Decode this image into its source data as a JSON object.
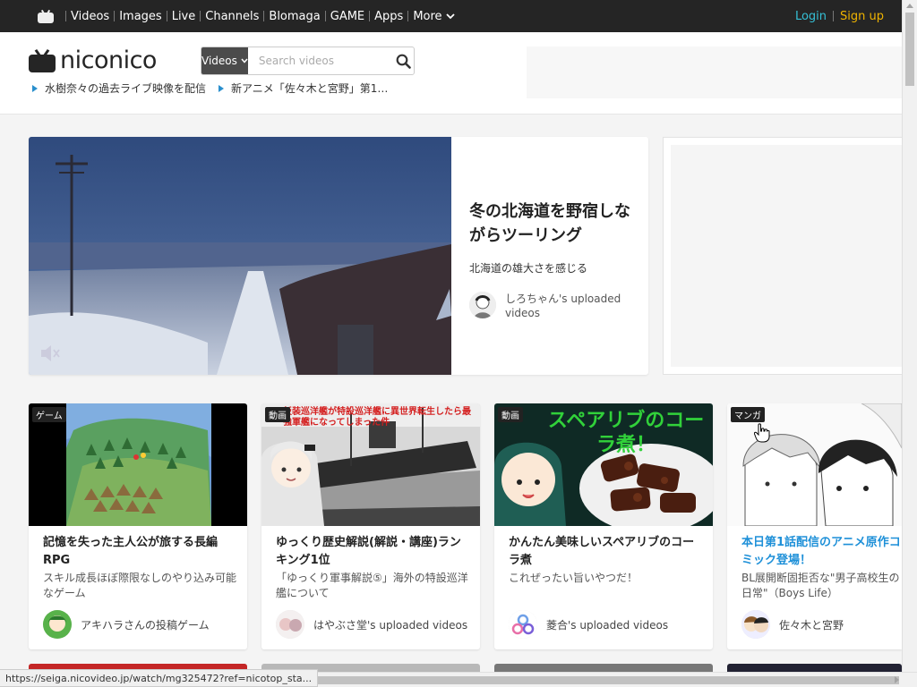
{
  "topbar": {
    "nav": [
      "Videos",
      "Images",
      "Live",
      "Channels",
      "Blomaga",
      "GAME",
      "Apps"
    ],
    "more_label": "More",
    "login_label": "Login",
    "signup_label": "Sign up"
  },
  "header": {
    "logo_text": "niconico",
    "search_type": "Videos",
    "search_placeholder": "Search videos",
    "pickups": [
      "水樹奈々の過去ライブ映像を配信",
      "新アニメ「佐々木と宮野」第1…"
    ]
  },
  "feature": {
    "title": "冬の北海道を野宿しながらツーリング",
    "subtitle": "北海道の雄大さを感じる",
    "author": "しろちゃん's uploaded videos"
  },
  "cards": [
    {
      "badge": "ゲーム",
      "title": "記憶を失った主人公が旅する長編RPG",
      "desc": "スキル成長ほぼ際限なしのやり込み可能なゲーム",
      "author": "アキハラさんの投稿ゲーム"
    },
    {
      "badge": "動画",
      "title": "ゆっくり歴史解説(解説・講座)ランキング1位",
      "desc": "「ゆっくり軍事解説⑤」海外の特設巡洋艦について",
      "author": "はやぶさ堂's uploaded videos"
    },
    {
      "badge": "動画",
      "title": "かんたん美味しいスペアリブのコーラ煮",
      "desc": "これぜったい旨いやつだ！",
      "author": "菱合's uploaded videos"
    },
    {
      "badge": "マンガ",
      "title": "本日第1話配信のアニメ原作コミック登場！",
      "desc": "BL展開断固拒否な\"男子高校生の日常\"（Boys Life）",
      "author": "佐々木と宮野"
    }
  ],
  "card_thumb_texts": {
    "card2_banner": "仮装巡洋艦が特設巡洋艦に異世界転生したら最強軍艦になってしまった件",
    "card3_banner": "スペアリブのコーラ煮！"
  },
  "status_url": "https://seiga.nicovideo.jp/watch/mg325472?ref=nicotop_sta..."
}
